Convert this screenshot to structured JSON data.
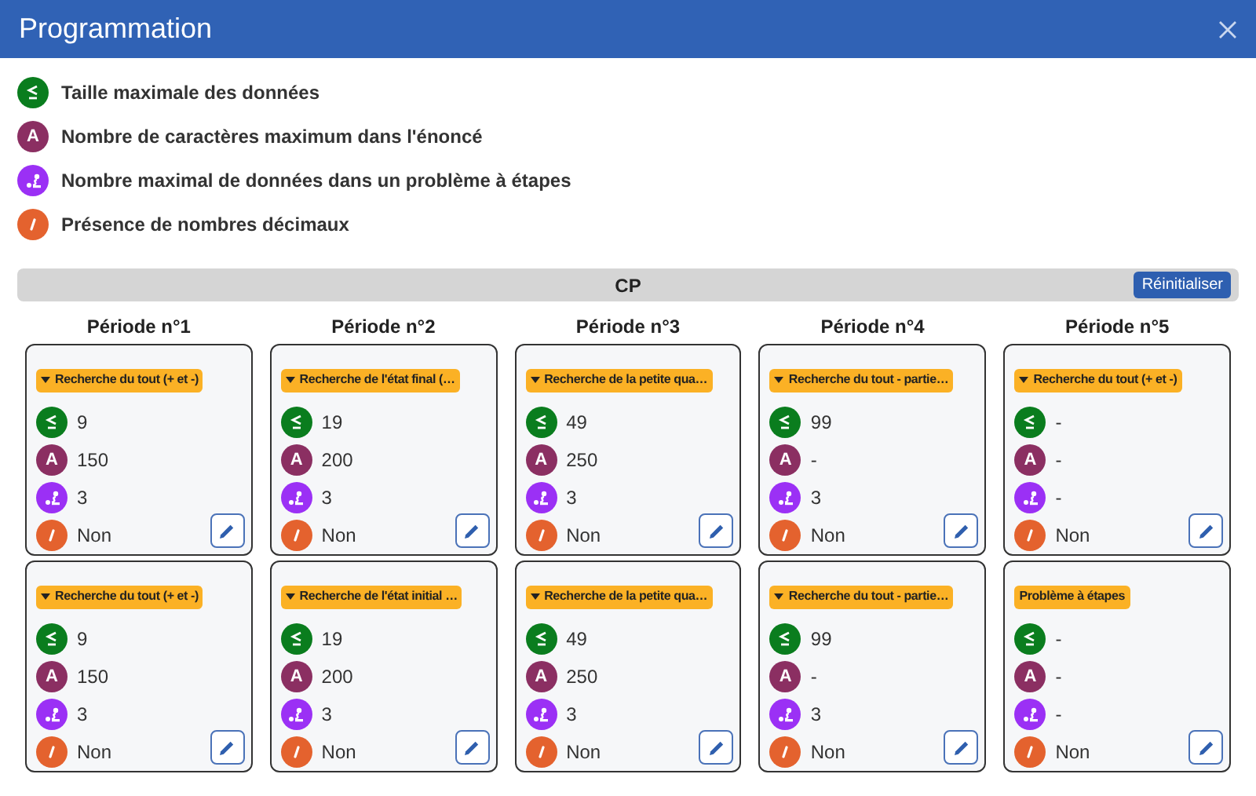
{
  "window": {
    "title": "Programmation"
  },
  "legend": [
    {
      "kind": "max_size",
      "color": "#0a7d1e",
      "label": "Taille maximale des données"
    },
    {
      "kind": "max_chars",
      "color": "#8b2f62",
      "symbol": "A",
      "label": "Nombre de caractères maximum dans l'énoncé"
    },
    {
      "kind": "max_steps",
      "color": "#9b30f5",
      "label": "Nombre maximal de données dans un problème à étapes"
    },
    {
      "kind": "decimals",
      "color": "#e4622e",
      "label": "Présence de nombres décimaux"
    }
  ],
  "section": {
    "title": "CP",
    "reset_button": "Réinitialiser"
  },
  "periods": [
    {
      "title": "Période n°1",
      "cards": [
        {
          "tag": {
            "text": "Recherche du tout (+ et -)",
            "caret": true
          },
          "rows": [
            {
              "kind": "max_size",
              "color": "#0a7d1e",
              "value": "9"
            },
            {
              "kind": "max_chars",
              "color": "#8b2f62",
              "symbol": "A",
              "value": "150"
            },
            {
              "kind": "max_steps",
              "color": "#9b30f5",
              "value": "3"
            },
            {
              "kind": "decimals",
              "color": "#e4622e",
              "value": "Non"
            }
          ]
        },
        {
          "tag": {
            "text": "Recherche du tout (+ et -)",
            "caret": true
          },
          "rows": [
            {
              "kind": "max_size",
              "color": "#0a7d1e",
              "value": "9"
            },
            {
              "kind": "max_chars",
              "color": "#8b2f62",
              "symbol": "A",
              "value": "150"
            },
            {
              "kind": "max_steps",
              "color": "#9b30f5",
              "value": "3"
            },
            {
              "kind": "decimals",
              "color": "#e4622e",
              "value": "Non"
            }
          ]
        }
      ]
    },
    {
      "title": "Période n°2",
      "cards": [
        {
          "tag": {
            "text": "Recherche de l'état final (…",
            "caret": true
          },
          "rows": [
            {
              "kind": "max_size",
              "color": "#0a7d1e",
              "value": "19"
            },
            {
              "kind": "max_chars",
              "color": "#8b2f62",
              "symbol": "A",
              "value": "200"
            },
            {
              "kind": "max_steps",
              "color": "#9b30f5",
              "value": "3"
            },
            {
              "kind": "decimals",
              "color": "#e4622e",
              "value": "Non"
            }
          ]
        },
        {
          "tag": {
            "text": "Recherche de l'état initial …",
            "caret": true
          },
          "rows": [
            {
              "kind": "max_size",
              "color": "#0a7d1e",
              "value": "19"
            },
            {
              "kind": "max_chars",
              "color": "#8b2f62",
              "symbol": "A",
              "value": "200"
            },
            {
              "kind": "max_steps",
              "color": "#9b30f5",
              "value": "3"
            },
            {
              "kind": "decimals",
              "color": "#e4622e",
              "value": "Non"
            }
          ]
        }
      ]
    },
    {
      "title": "Période n°3",
      "cards": [
        {
          "tag": {
            "text": "Recherche de la petite qua…",
            "caret": true
          },
          "rows": [
            {
              "kind": "max_size",
              "color": "#0a7d1e",
              "value": "49"
            },
            {
              "kind": "max_chars",
              "color": "#8b2f62",
              "symbol": "A",
              "value": "250"
            },
            {
              "kind": "max_steps",
              "color": "#9b30f5",
              "value": "3"
            },
            {
              "kind": "decimals",
              "color": "#e4622e",
              "value": "Non"
            }
          ]
        },
        {
          "tag": {
            "text": "Recherche de la petite qua…",
            "caret": true
          },
          "rows": [
            {
              "kind": "max_size",
              "color": "#0a7d1e",
              "value": "49"
            },
            {
              "kind": "max_chars",
              "color": "#8b2f62",
              "symbol": "A",
              "value": "250"
            },
            {
              "kind": "max_steps",
              "color": "#9b30f5",
              "value": "3"
            },
            {
              "kind": "decimals",
              "color": "#e4622e",
              "value": "Non"
            }
          ]
        }
      ]
    },
    {
      "title": "Période n°4",
      "cards": [
        {
          "tag": {
            "text": "Recherche du tout - partie…",
            "caret": true
          },
          "rows": [
            {
              "kind": "max_size",
              "color": "#0a7d1e",
              "value": "99"
            },
            {
              "kind": "max_chars",
              "color": "#8b2f62",
              "symbol": "A",
              "value": "-"
            },
            {
              "kind": "max_steps",
              "color": "#9b30f5",
              "value": "3"
            },
            {
              "kind": "decimals",
              "color": "#e4622e",
              "value": "Non"
            }
          ]
        },
        {
          "tag": {
            "text": "Recherche du tout - partie…",
            "caret": true
          },
          "rows": [
            {
              "kind": "max_size",
              "color": "#0a7d1e",
              "value": "99"
            },
            {
              "kind": "max_chars",
              "color": "#8b2f62",
              "symbol": "A",
              "value": "-"
            },
            {
              "kind": "max_steps",
              "color": "#9b30f5",
              "value": "3"
            },
            {
              "kind": "decimals",
              "color": "#e4622e",
              "value": "Non"
            }
          ]
        }
      ]
    },
    {
      "title": "Période n°5",
      "cards": [
        {
          "tag": {
            "text": "Recherche du tout (+ et -)",
            "caret": true
          },
          "rows": [
            {
              "kind": "max_size",
              "color": "#0a7d1e",
              "value": "-"
            },
            {
              "kind": "max_chars",
              "color": "#8b2f62",
              "symbol": "A",
              "value": "-"
            },
            {
              "kind": "max_steps",
              "color": "#9b30f5",
              "value": "-"
            },
            {
              "kind": "decimals",
              "color": "#e4622e",
              "value": "Non"
            }
          ]
        },
        {
          "tag": {
            "text": "Problème à étapes",
            "caret": false
          },
          "rows": [
            {
              "kind": "max_size",
              "color": "#0a7d1e",
              "value": "-"
            },
            {
              "kind": "max_chars",
              "color": "#8b2f62",
              "symbol": "A",
              "value": "-"
            },
            {
              "kind": "max_steps",
              "color": "#9b30f5",
              "value": "-"
            },
            {
              "kind": "decimals",
              "color": "#e4622e",
              "value": "Non"
            }
          ]
        }
      ]
    }
  ]
}
